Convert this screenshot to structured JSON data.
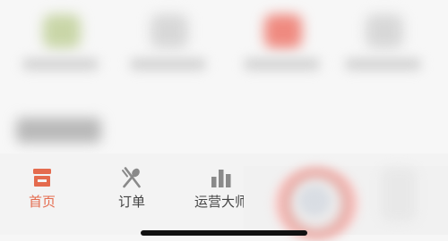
{
  "tabbar": {
    "tabs": [
      {
        "label": "首页",
        "icon": "store-icon",
        "active": true
      },
      {
        "label": "订单",
        "icon": "utensils-icon",
        "active": false
      },
      {
        "label": "运营大师",
        "icon": "bar-chart-icon",
        "active": false
      }
    ]
  },
  "colors": {
    "accent": "#e46b4e",
    "tab_text": "#444444",
    "icon_inactive": "#8a8a8a"
  },
  "content": {
    "shortcut_colors": [
      "#c9d6a8",
      "#d8d8d8",
      "#ef8a80",
      "#d8d8d8"
    ]
  }
}
